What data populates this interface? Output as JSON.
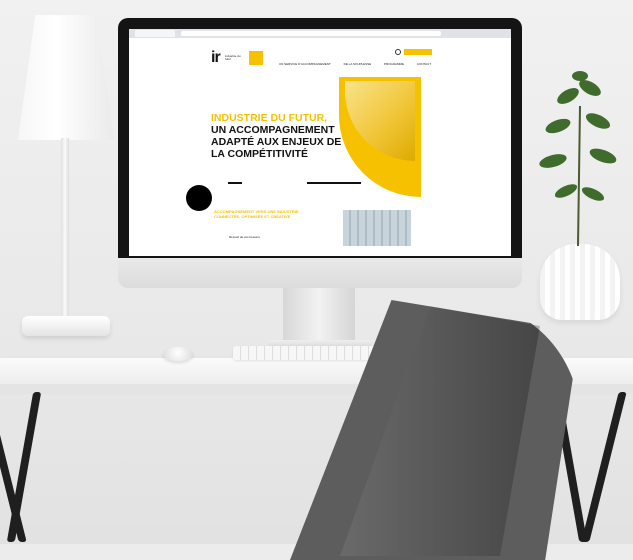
{
  "screen": {
    "logo_letters": "ir",
    "logo_text": "industrie du futur",
    "nav_items": [
      "UN SERVICE D'ACCOMPAGNEMENT",
      "DE LA SOUPLESSE",
      "PROGRAMME",
      "CONTACT"
    ],
    "hero_title": {
      "line1": "INDUSTRIE DU FUTUR,",
      "line2": "UN ACCOMPAGNEMENT",
      "line3": "ADAPTÉ AUX ENJEUX DE",
      "line4": "LA COMPÉTITIVITÉ"
    },
    "subheading": "ACCOMPAGNEMENT VERS UNE INDUSTRIE CONNECTÉE, OPTIMISÉE ET CRÉATIVE",
    "bullet": "Recueil de vos besoins"
  },
  "colors": {
    "accent": "#f6c200",
    "dark": "#111111",
    "chair": "#5d5d5d"
  }
}
